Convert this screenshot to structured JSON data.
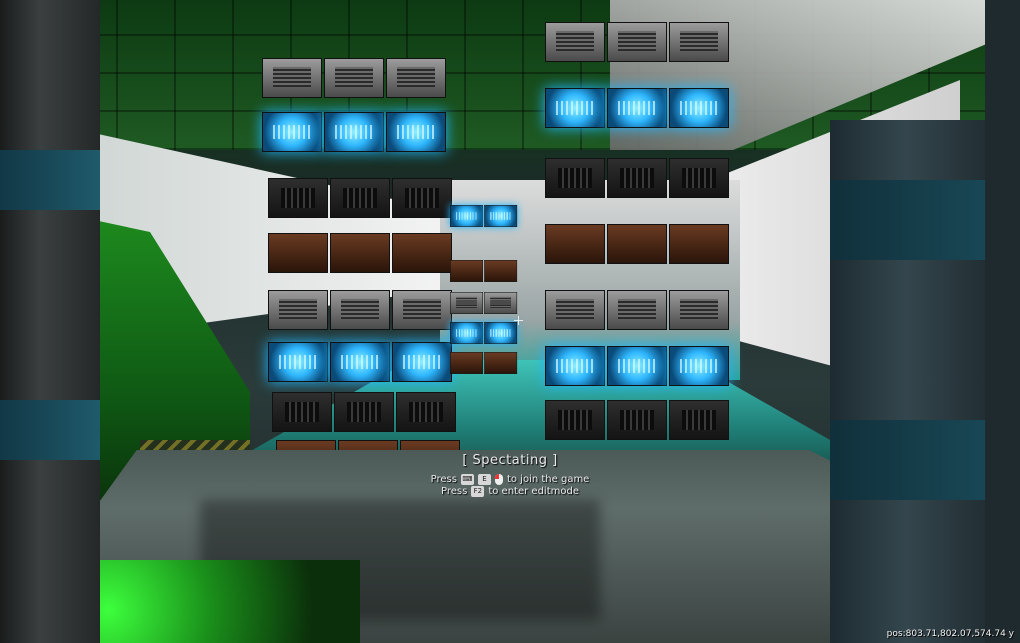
{
  "hud": {
    "title": "[ Spectating ]",
    "line1_prefix": "Press",
    "line1_key": "E",
    "line1_icon": "mouse-left-click-icon",
    "line1_suffix": "to join the game",
    "line2_prefix": "Press",
    "line2_key": "F2",
    "line2_suffix": "to enter editmode"
  },
  "position_readout": "pos:803.71,802.07,574.74 y"
}
